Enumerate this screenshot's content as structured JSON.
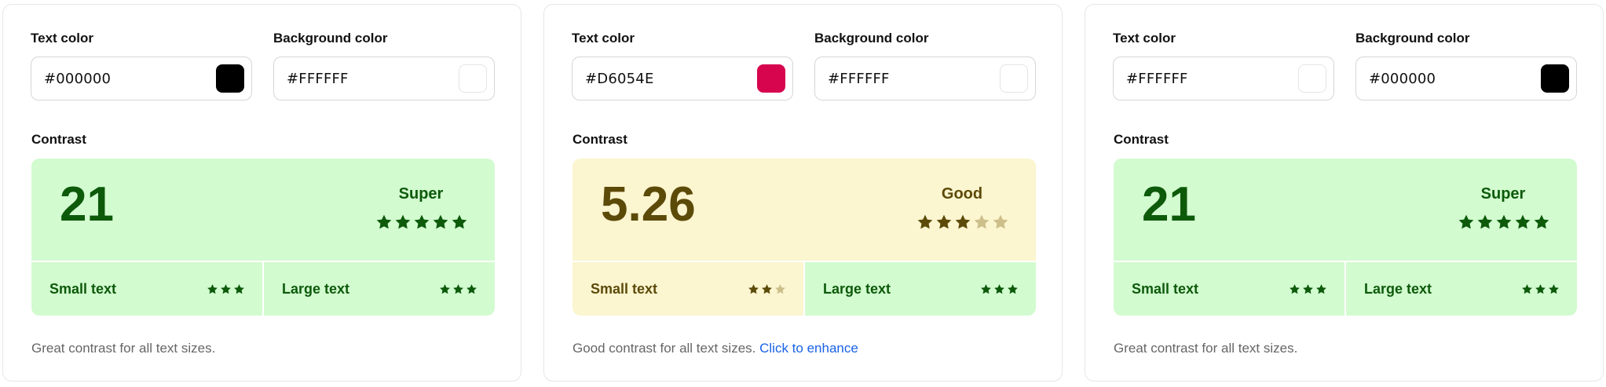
{
  "colors": {
    "green_bg": "#d2fbd0",
    "green_text": "#0d5a0a",
    "yellow_bg": "#fbf5d0",
    "yellow_text": "#5c4a08",
    "star_dim_yellow": "#cdbf8a",
    "link": "#1a62e6"
  },
  "cards": [
    {
      "text_color_label": "Text color",
      "background_color_label": "Background color",
      "text_color_value": "#000000",
      "text_color_swatch": "#000000",
      "background_color_value": "#FFFFFF",
      "background_color_swatch": "#FFFFFF",
      "contrast_label": "Contrast",
      "ratio": "21",
      "rating": "Super",
      "stars_filled": 5,
      "stars_total": 5,
      "small_text_label": "Small text",
      "small_text_stars_filled": 3,
      "large_text_label": "Large text",
      "large_text_stars_filled": 3,
      "message": "Great contrast for all text sizes.",
      "message_link": "",
      "theme": "green",
      "small_theme": "green",
      "large_theme": "green"
    },
    {
      "text_color_label": "Text color",
      "background_color_label": "Background color",
      "text_color_value": "#D6054E",
      "text_color_swatch": "#D6054E",
      "background_color_value": "#FFFFFF",
      "background_color_swatch": "#FFFFFF",
      "contrast_label": "Contrast",
      "ratio": "5.26",
      "rating": "Good",
      "stars_filled": 3,
      "stars_total": 5,
      "small_text_label": "Small text",
      "small_text_stars_filled": 2,
      "large_text_label": "Large text",
      "large_text_stars_filled": 3,
      "message": "Good contrast for all text sizes.",
      "message_link": "Click to enhance",
      "theme": "yellow",
      "small_theme": "yellow",
      "large_theme": "green"
    },
    {
      "text_color_label": "Text color",
      "background_color_label": "Background color",
      "text_color_value": "#FFFFFF",
      "text_color_swatch": "#FFFFFF",
      "background_color_value": "#000000",
      "background_color_swatch": "#000000",
      "contrast_label": "Contrast",
      "ratio": "21",
      "rating": "Super",
      "stars_filled": 5,
      "stars_total": 5,
      "small_text_label": "Small text",
      "small_text_stars_filled": 3,
      "large_text_label": "Large text",
      "large_text_stars_filled": 3,
      "message": "Great contrast for all text sizes.",
      "message_link": "",
      "theme": "green",
      "small_theme": "green",
      "large_theme": "green"
    }
  ]
}
